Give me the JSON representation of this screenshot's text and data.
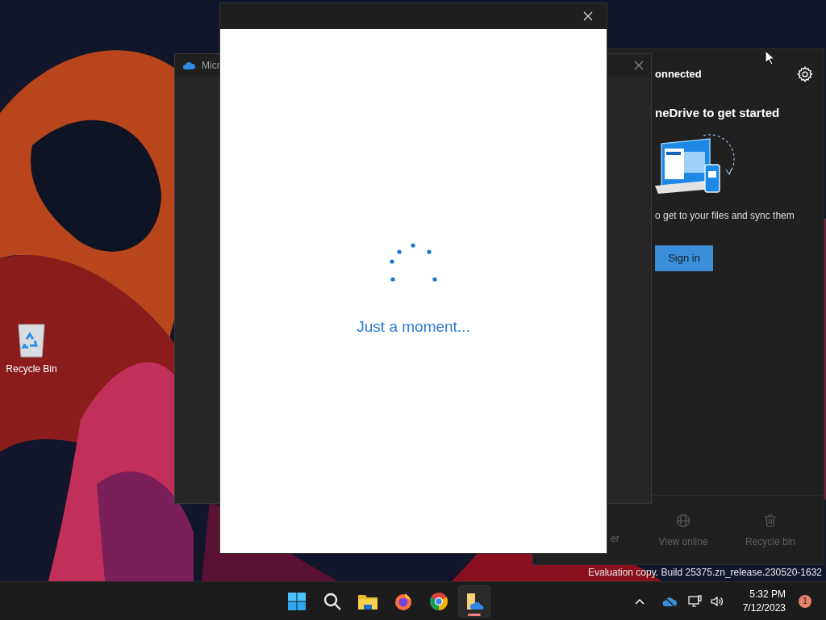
{
  "desktop": {
    "icons": [
      {
        "label": "Recycle Bin"
      }
    ]
  },
  "onedrive_panel": {
    "status": "onnected",
    "heading": "neDrive to get started",
    "description": "o get to your files and sync them",
    "sign_in_button": "Sign in",
    "footer": [
      {
        "kind": "label",
        "label": "er"
      },
      {
        "kind": "globe",
        "label": "View online"
      },
      {
        "kind": "trash",
        "label": "Recycle bin"
      }
    ]
  },
  "background_window": {
    "title": "Micr"
  },
  "dialog": {
    "message": "Just a moment..."
  },
  "build_info": "Evaluation copy. Build 25375.zn_release.230520-1632",
  "taskbar": {
    "apps": [
      {
        "kind": "start",
        "selected": false
      },
      {
        "kind": "search",
        "selected": false
      },
      {
        "kind": "folder",
        "selected": false
      },
      {
        "kind": "firefox",
        "selected": false
      },
      {
        "kind": "chrome",
        "selected": false
      },
      {
        "kind": "onedrive",
        "selected": true
      }
    ],
    "clock": {
      "time": "5:32 PM",
      "date": "7/12/2023"
    },
    "notifications": "1"
  }
}
